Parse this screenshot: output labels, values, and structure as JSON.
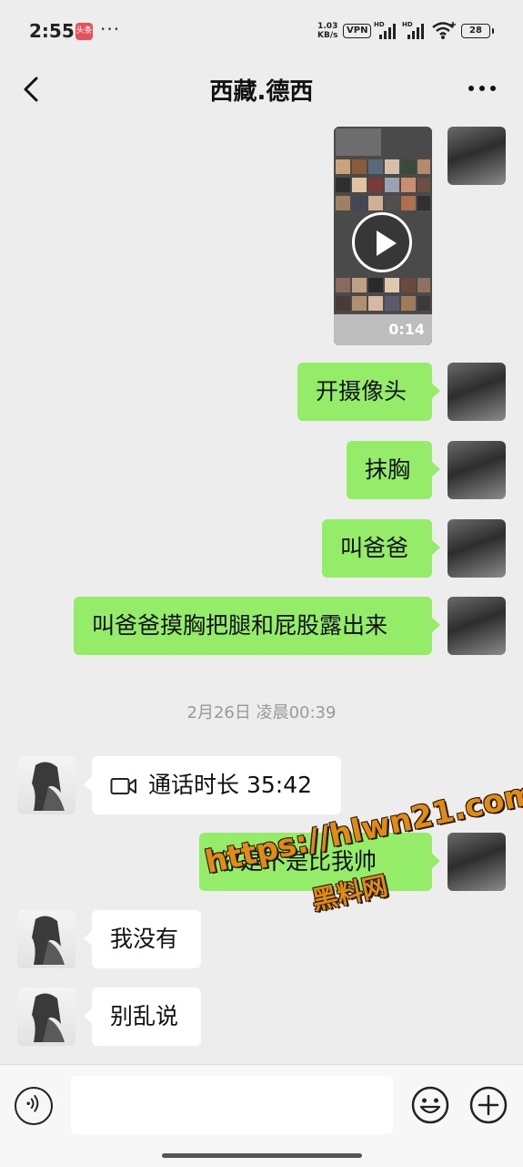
{
  "status_bar": {
    "time": "2:55",
    "app_badge": "头条",
    "more": "···",
    "net_speed_value": "1.03",
    "net_speed_unit": "KB/s",
    "vpn": "VPN",
    "hd1": "HD",
    "hd2": "HD",
    "battery": "28"
  },
  "header": {
    "title": "西藏.德西",
    "back_icon": "chevron-left-icon",
    "more_icon": "more-dots-icon"
  },
  "messages": [
    {
      "sender": "me",
      "type": "video",
      "duration": "0:14"
    },
    {
      "sender": "me",
      "type": "text",
      "text": "开摄像头"
    },
    {
      "sender": "me",
      "type": "text",
      "text": "抹胸"
    },
    {
      "sender": "me",
      "type": "text",
      "text": "叫爸爸"
    },
    {
      "sender": "me",
      "type": "text",
      "text": "叫爸爸摸胸把腿和屁股露出来"
    },
    {
      "type": "timestamp",
      "text": "2月26日 凌晨00:39"
    },
    {
      "sender": "them",
      "type": "call",
      "text": "通话时长 35:42"
    },
    {
      "sender": "me",
      "type": "text",
      "text": "你是不是比我帅"
    },
    {
      "sender": "them",
      "type": "text",
      "text": "我没有"
    },
    {
      "sender": "them",
      "type": "text",
      "text": "别乱说"
    }
  ],
  "watermark": {
    "url": "https://hlwn21.com",
    "name": "黑料网"
  },
  "input_bar": {
    "placeholder": "",
    "voice_icon": "voice-icon",
    "emoji_icon": "emoji-icon",
    "plus_icon": "plus-icon"
  },
  "colors": {
    "background": "#ededed",
    "my_bubble": "#95ec69",
    "their_bubble": "#ffffff",
    "watermark": "#e08c14"
  }
}
